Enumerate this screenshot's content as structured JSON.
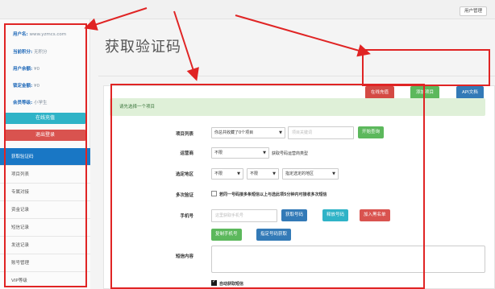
{
  "topbar": {
    "user_manage": "用户管理"
  },
  "sidebar": {
    "info": [
      {
        "label": "用户名:",
        "value": "www.yzmcs.com"
      },
      {
        "label": "当前积分:",
        "value": "无积分"
      },
      {
        "label": "用户余额:",
        "value": "¥0"
      },
      {
        "label": "锁定金额:",
        "value": "¥0"
      },
      {
        "label": "会员等级:",
        "value": "小学生"
      }
    ],
    "online_support": "在线充值",
    "logout": "退出登录",
    "nav": [
      "获取验证码",
      "项目列表",
      "专属对接",
      "资金记录",
      "短信记录",
      "发送记录",
      "账号管理",
      "VIP等级"
    ]
  },
  "main": {
    "title": "获取验证码",
    "header_buttons": {
      "support": "在线充值",
      "add_project": "添加项目",
      "api_docs": "API文档"
    },
    "alert": "请先选择一个项目",
    "form": {
      "project_list_label": "项目列表",
      "project_select": "你总共收藏了0个项目",
      "project_search_placeholder": "项目关键词",
      "open_search_button": "开始查询",
      "operator_label": "运营商",
      "operator_select": "不限",
      "operator_hint": "获取号码运营商类型",
      "region_label": "选定地区",
      "province_select": "不限",
      "city_select": "不限",
      "region_select": "指定选定的地区",
      "multi_label": "多次验证",
      "multi_hint": "若同一号码接多条短信以上与选此项5分钟内可接收多次短信",
      "phone_label": "手机号",
      "phone_placeholder": "这里获取手机号",
      "get_number": "获取号码",
      "release_number": "释放号码",
      "blacklist": "加入黑名单",
      "copy_phone": "复制手机号",
      "specify_number": "指定号码获取",
      "sms_content_label": "短信内容",
      "auto_sms": "自动获取短信"
    }
  }
}
